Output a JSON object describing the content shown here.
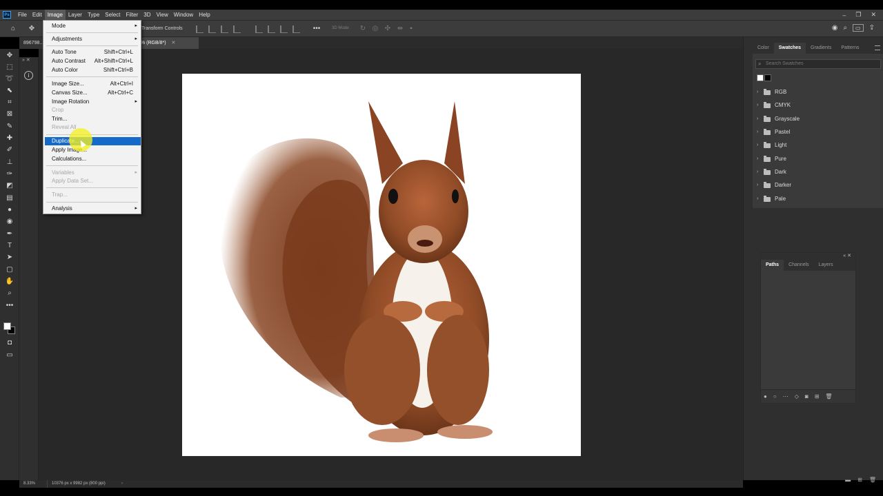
{
  "menubar": {
    "logo": "Ps",
    "items": [
      "File",
      "Edit",
      "Image",
      "Layer",
      "Type",
      "Select",
      "Filter",
      "3D",
      "View",
      "Window",
      "Help"
    ],
    "active": "Image"
  },
  "options_bar": {
    "transform_label": "Transform Controls",
    "mode_3d": "3D Mode:"
  },
  "tabs": {
    "first": "896798...",
    "second": "% (RGB/8*)"
  },
  "image_menu": {
    "items": [
      {
        "label": "Mode",
        "has_submenu": true
      },
      {
        "label": "Adjustments",
        "has_submenu": true
      },
      {
        "label": "Auto Tone",
        "shortcut": "Shift+Ctrl+L"
      },
      {
        "label": "Auto Contrast",
        "shortcut": "Alt+Shift+Ctrl+L"
      },
      {
        "label": "Auto Color",
        "shortcut": "Shift+Ctrl+B"
      },
      {
        "label": "Image Size...",
        "shortcut": "Alt+Ctrl+I"
      },
      {
        "label": "Canvas Size...",
        "shortcut": "Alt+Ctrl+C"
      },
      {
        "label": "Image Rotation",
        "has_submenu": true
      },
      {
        "label": "Crop",
        "disabled": true
      },
      {
        "label": "Trim..."
      },
      {
        "label": "Reveal All",
        "disabled": true
      },
      {
        "label": "Duplicate...",
        "highlighted": true
      },
      {
        "label": "Apply Image..."
      },
      {
        "label": "Calculations..."
      },
      {
        "label": "Variables",
        "has_submenu": true,
        "disabled": true
      },
      {
        "label": "Apply Data Set...",
        "disabled": true
      },
      {
        "label": "Trap...",
        "disabled": true
      },
      {
        "label": "Analysis",
        "has_submenu": true
      }
    ]
  },
  "swatches_panel": {
    "tabs": [
      "Color",
      "Swatches",
      "Gradients",
      "Patterns"
    ],
    "active_tab": "Swatches",
    "search_placeholder": "Search Swatches",
    "recent_colors": [
      "#ffffff",
      "#000000"
    ],
    "folders": [
      "RGB",
      "CMYK",
      "Grayscale",
      "Pastel",
      "Light",
      "Pure",
      "Dark",
      "Darker",
      "Pale"
    ]
  },
  "paths_panel": {
    "tabs": [
      "Paths",
      "Channels",
      "Layers"
    ],
    "active_tab": "Paths"
  },
  "status_bar": {
    "zoom": "8.33%",
    "dimensions": "10376 px x 9982 px (800 ppi)"
  },
  "colors": {
    "menu_highlight": "#1469c9",
    "foreground": "#ffffff",
    "background": "#000000",
    "cursor_highlight": "#f4f124"
  }
}
